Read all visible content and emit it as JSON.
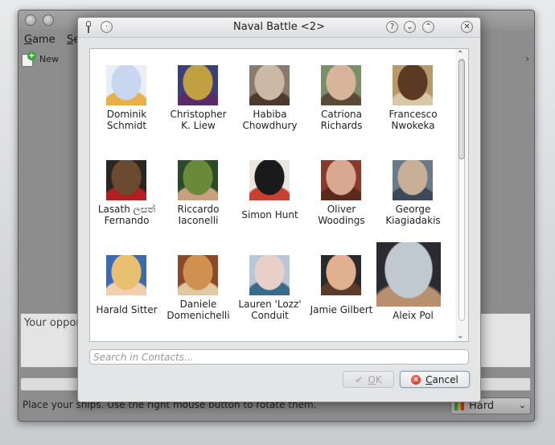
{
  "main_window": {
    "menus": [
      {
        "label": "Game",
        "accel": "G"
      },
      {
        "label": "Se",
        "accel": "S"
      }
    ],
    "toolbar": {
      "new_label": "New",
      "overflow_icon": "chevron-right-icon"
    },
    "chat_text": "Your oppon",
    "status_text": "Place your ships. Use the right mouse button to rotate them.",
    "difficulty": {
      "label": "Hard",
      "icon": "difficulty-bars-icon"
    }
  },
  "dialog": {
    "title": "Naval Battle <2>",
    "title_buttons": [
      {
        "name": "help-button",
        "glyph": "?"
      },
      {
        "name": "minimize-button",
        "glyph": "⌄"
      },
      {
        "name": "maximize-button",
        "glyph": "⌃"
      },
      {
        "name": "close-button",
        "glyph": "✕"
      }
    ],
    "contacts": [
      {
        "name": "Dominik\nSchmidt",
        "colors": [
          "#e9eef7",
          "#c8d6ef",
          "#e8b04a"
        ]
      },
      {
        "name": "Christopher\nK. Liew",
        "colors": [
          "#3a3f7a",
          "#c0a040",
          "#5a2a6a"
        ]
      },
      {
        "name": "Habiba\nChowdhury",
        "colors": [
          "#8a7a6e",
          "#c9b9a5",
          "#4a3a30"
        ]
      },
      {
        "name": "Catriona\nRichards",
        "colors": [
          "#7a8e6a",
          "#d8b49a",
          "#5a4a3a"
        ]
      },
      {
        "name": "Francesco\nNwokeka",
        "colors": [
          "#b89a6a",
          "#5a3a22",
          "#d8c8a8"
        ]
      },
      {
        "name": "Lasath ලසත්\nFernando",
        "colors": [
          "#2a2520",
          "#6a4a30",
          "#b02020"
        ]
      },
      {
        "name": "Riccardo\nIaconelli",
        "colors": [
          "#2a4a2a",
          "#6a8a3a",
          "#c8a080"
        ]
      },
      {
        "name": "Simon Hunt",
        "colors": [
          "#ece6e0",
          "#1a1a1a",
          "#c84030"
        ]
      },
      {
        "name": "Oliver\nWoodings",
        "colors": [
          "#8a3a2a",
          "#d8a890",
          "#5a2a1a"
        ]
      },
      {
        "name": "George\nKiagiadakis",
        "colors": [
          "#6a7a8a",
          "#c8b098",
          "#3a4a5a"
        ]
      },
      {
        "name": "Harald Sitter",
        "colors": [
          "#3a6ab0",
          "#e8c070",
          "#f0d0b0"
        ]
      },
      {
        "name": "Daniele\nDomenichelli",
        "colors": [
          "#8a4a2a",
          "#d09050",
          "#e0c8a0"
        ]
      },
      {
        "name": "Lauren 'Lozz'\nConduit",
        "colors": [
          "#b8c8d8",
          "#e8d0c8",
          "#3a6a8a"
        ]
      },
      {
        "name": "Jamie Gilbert",
        "colors": [
          "#2a2a2a",
          "#e0b090",
          "#5a3a2a"
        ]
      },
      {
        "name": "Aleix Pol",
        "colors": [
          "#2a2a30",
          "#c0c8d0",
          "#b89070"
        ]
      },
      {
        "name": "",
        "colors": [
          "#c87030",
          "#a05020",
          "#3a3a3a"
        ]
      },
      {
        "name": "",
        "colors": [
          "#5a6a4a",
          "#3a4a2a",
          "#8a8a6a"
        ]
      },
      {
        "name": "",
        "colors": [
          "#b04030",
          "#7a2a20",
          "#d8a090"
        ]
      },
      {
        "name": "",
        "colors": [
          "#6a2a2a",
          "#c06040",
          "#3a2020"
        ]
      },
      {
        "name": "",
        "colors": [
          "#c8c8c8",
          "#9a9a9a",
          "#5a5a5a"
        ]
      }
    ],
    "search": {
      "placeholder": "Search in Contacts...",
      "value": ""
    },
    "ok_button": {
      "label": "OK",
      "accel": "O",
      "icon": "check-icon"
    },
    "cancel_button": {
      "label": "Cancel",
      "accel": "C",
      "icon": "cancel-icon"
    }
  }
}
